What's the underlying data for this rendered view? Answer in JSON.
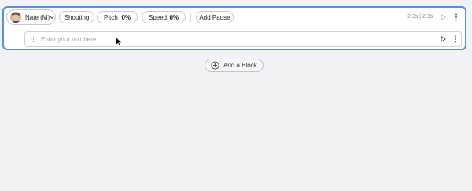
{
  "voice": {
    "name": "Nate (M)",
    "avatar": "voice-avatar-photo"
  },
  "toolbar": {
    "style_label": "Shouting",
    "pitch_label": "Pitch",
    "pitch_value": "0%",
    "speed_label": "Speed",
    "speed_value": "0%",
    "add_pause_label": "Add Pause",
    "timing": "2.3s | 2.3s"
  },
  "editor": {
    "placeholder": "Enter your text here",
    "value": ""
  },
  "add_block": {
    "label": "Add a Block"
  },
  "colors": {
    "accent_border": "#5a8fe0",
    "background": "#f2f2f4"
  },
  "icons": [
    "chevron-down-icon",
    "play-icon",
    "more-vertical-icon",
    "drag-handle-icon",
    "plus-circle-icon",
    "mouse-cursor-icon"
  ]
}
